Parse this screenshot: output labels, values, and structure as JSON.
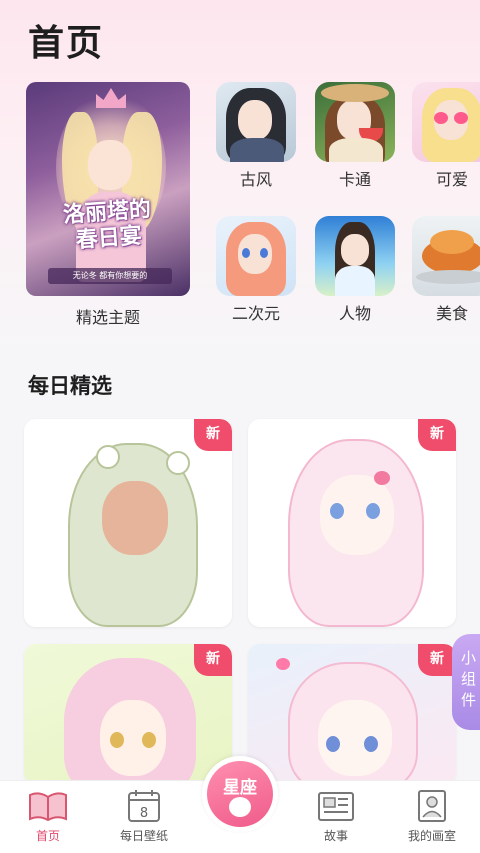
{
  "header": {
    "title": "首页"
  },
  "featured": {
    "title_line1": "洛丽塔的",
    "title_line2": "春日宴",
    "subtitle": "无论冬  都有你想要的",
    "label": "精选主题"
  },
  "categories": [
    {
      "label": "古风"
    },
    {
      "label": "卡通"
    },
    {
      "label": "可爱"
    },
    {
      "label": "二次元"
    },
    {
      "label": "人物"
    },
    {
      "label": "美食"
    }
  ],
  "daily": {
    "title": "每日精选",
    "badge": "新"
  },
  "widget_tab": {
    "label": "小组件"
  },
  "nav": {
    "home": "首页",
    "daily_wallpaper": "每日壁纸",
    "center": "星座",
    "story": "故事",
    "studio": "我的画室"
  },
  "colors": {
    "accent": "#e04a6d",
    "badge": "#ef4d6b",
    "widget": "#b99af0"
  }
}
